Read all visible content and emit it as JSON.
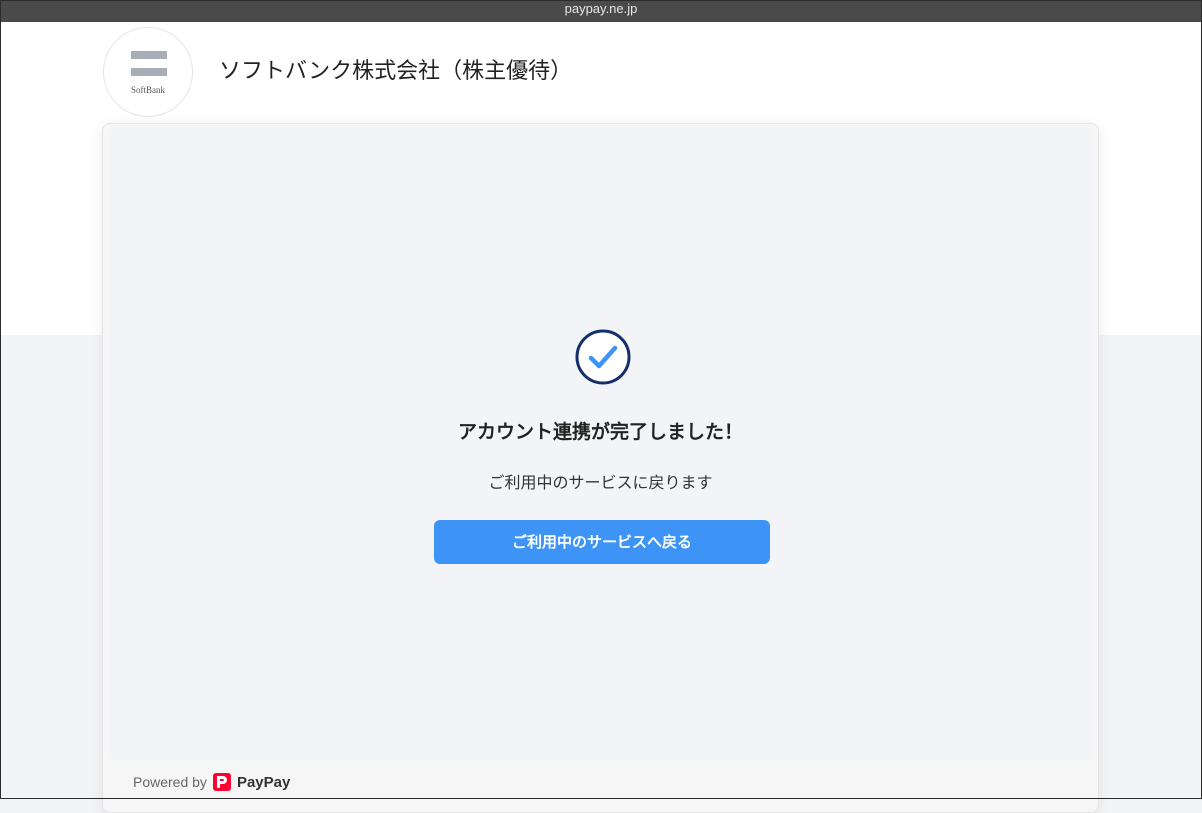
{
  "browser": {
    "url": "paypay.ne.jp"
  },
  "merchant": {
    "logo_text": "SoftBank",
    "name": "ソフトバンク株式会社（株主優待）"
  },
  "result": {
    "icon": "check-circle-icon",
    "heading": "アカウント連携が完了しました！",
    "message": "ご利用中のサービスに戻ります",
    "button_label": "ご利用中のサービスへ戻る"
  },
  "footer": {
    "powered_by": "Powered by",
    "brand": "PayPay"
  },
  "colors": {
    "accent": "#3d94f6",
    "check_ring": "#13306b",
    "check_mark": "#3d94f6",
    "brand_red": "#ff0033"
  }
}
